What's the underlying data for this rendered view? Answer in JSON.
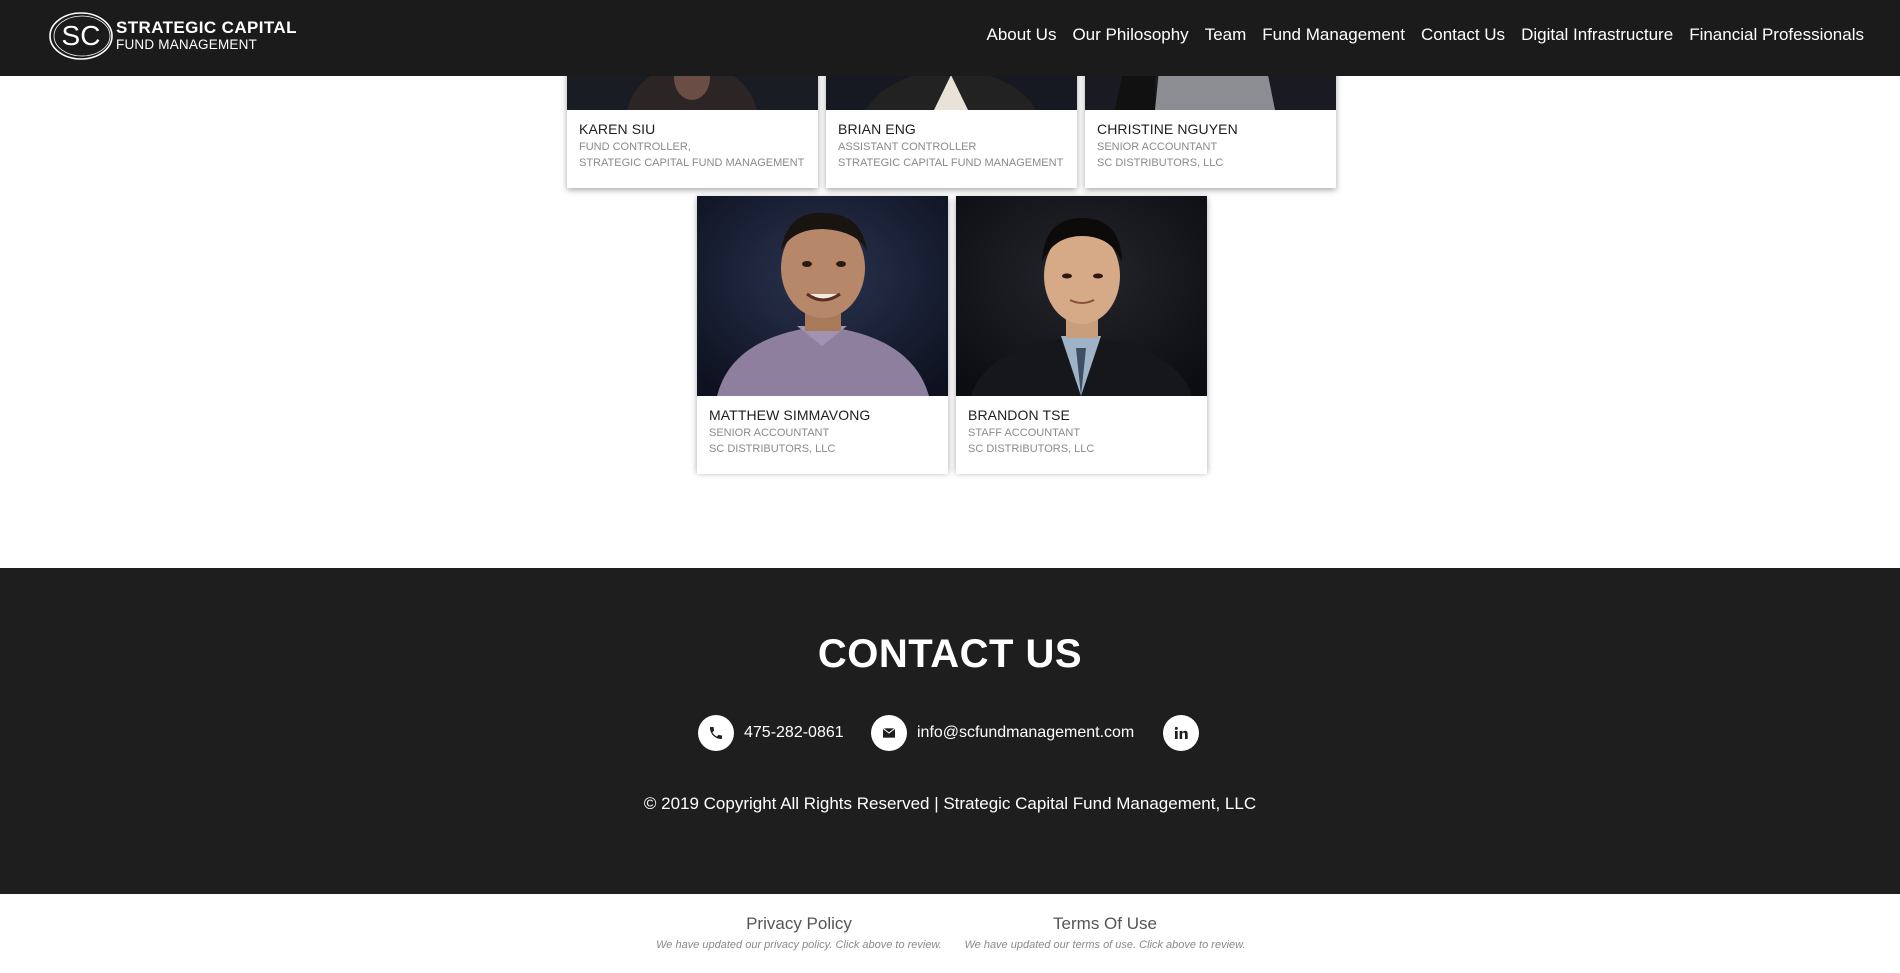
{
  "header": {
    "logo": {
      "mark": "SC",
      "line1": "STRATEGIC CAPITAL",
      "line2": "FUND MANAGEMENT"
    },
    "nav": [
      {
        "label": "About Us"
      },
      {
        "label": "Our Philosophy"
      },
      {
        "label": "Team"
      },
      {
        "label": "Fund Management"
      },
      {
        "label": "Contact Us"
      },
      {
        "label": "Digital Infrastructure"
      },
      {
        "label": "Financial Professionals"
      }
    ]
  },
  "team": {
    "members": [
      {
        "name": "KAREN SIU",
        "role": "FUND CONTROLLER,",
        "org": "STRATEGIC CAPITAL FUND MANAGEMENT"
      },
      {
        "name": "BRIAN ENG",
        "role": "ASSISTANT CONTROLLER",
        "org": "STRATEGIC CAPITAL FUND MANAGEMENT"
      },
      {
        "name": "CHRISTINE NGUYEN",
        "role": "SENIOR ACCOUNTANT",
        "org": "SC DISTRIBUTORS, LLC"
      },
      {
        "name": "MATTHEW SIMMAVONG",
        "role": "SENIOR ACCOUNTANT",
        "org": "SC DISTRIBUTORS, LLC"
      },
      {
        "name": "BRANDON TSE",
        "role": "STAFF ACCOUNTANT",
        "org": "SC DISTRIBUTORS, LLC"
      }
    ]
  },
  "contact": {
    "title": "CONTACT US",
    "phone": "475-282-0861",
    "email": "info@scfundmanagement.com",
    "copyright": "© 2019 Copyright All Rights Reserved | Strategic Capital Fund Management, LLC"
  },
  "legal": {
    "privacy_label": "Privacy Policy",
    "privacy_note": "We have updated our privacy policy. Click above to review.",
    "terms_label": "Terms Of Use",
    "terms_note": "We have updated our terms of use. Click above to review."
  },
  "colors": {
    "header_bg": "#1b1b1b",
    "contact_bg": "#1e1e1e",
    "photo_bg": "#15192a"
  }
}
